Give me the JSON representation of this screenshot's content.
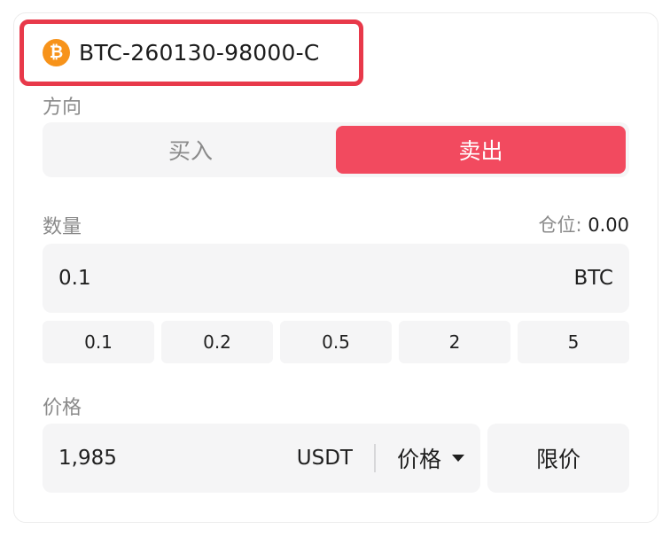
{
  "symbol": {
    "icon": "bitcoin-icon",
    "icon_glyph": "₿",
    "name": "BTC-260130-98000-C",
    "highlight_color": "#e8394a"
  },
  "direction": {
    "label": "方向",
    "buy_label": "买入",
    "sell_label": "卖出",
    "selected": "sell",
    "sell_color": "#f24a5f"
  },
  "quantity": {
    "label": "数量",
    "position_label": "仓位:",
    "position_value": "0.00",
    "value": "0.1",
    "unit": "BTC",
    "presets": [
      "0.1",
      "0.2",
      "0.5",
      "2",
      "5"
    ]
  },
  "price": {
    "label": "价格",
    "value": "1,985",
    "unit": "USDT",
    "type_label": "价格",
    "limit_label": "限价"
  }
}
